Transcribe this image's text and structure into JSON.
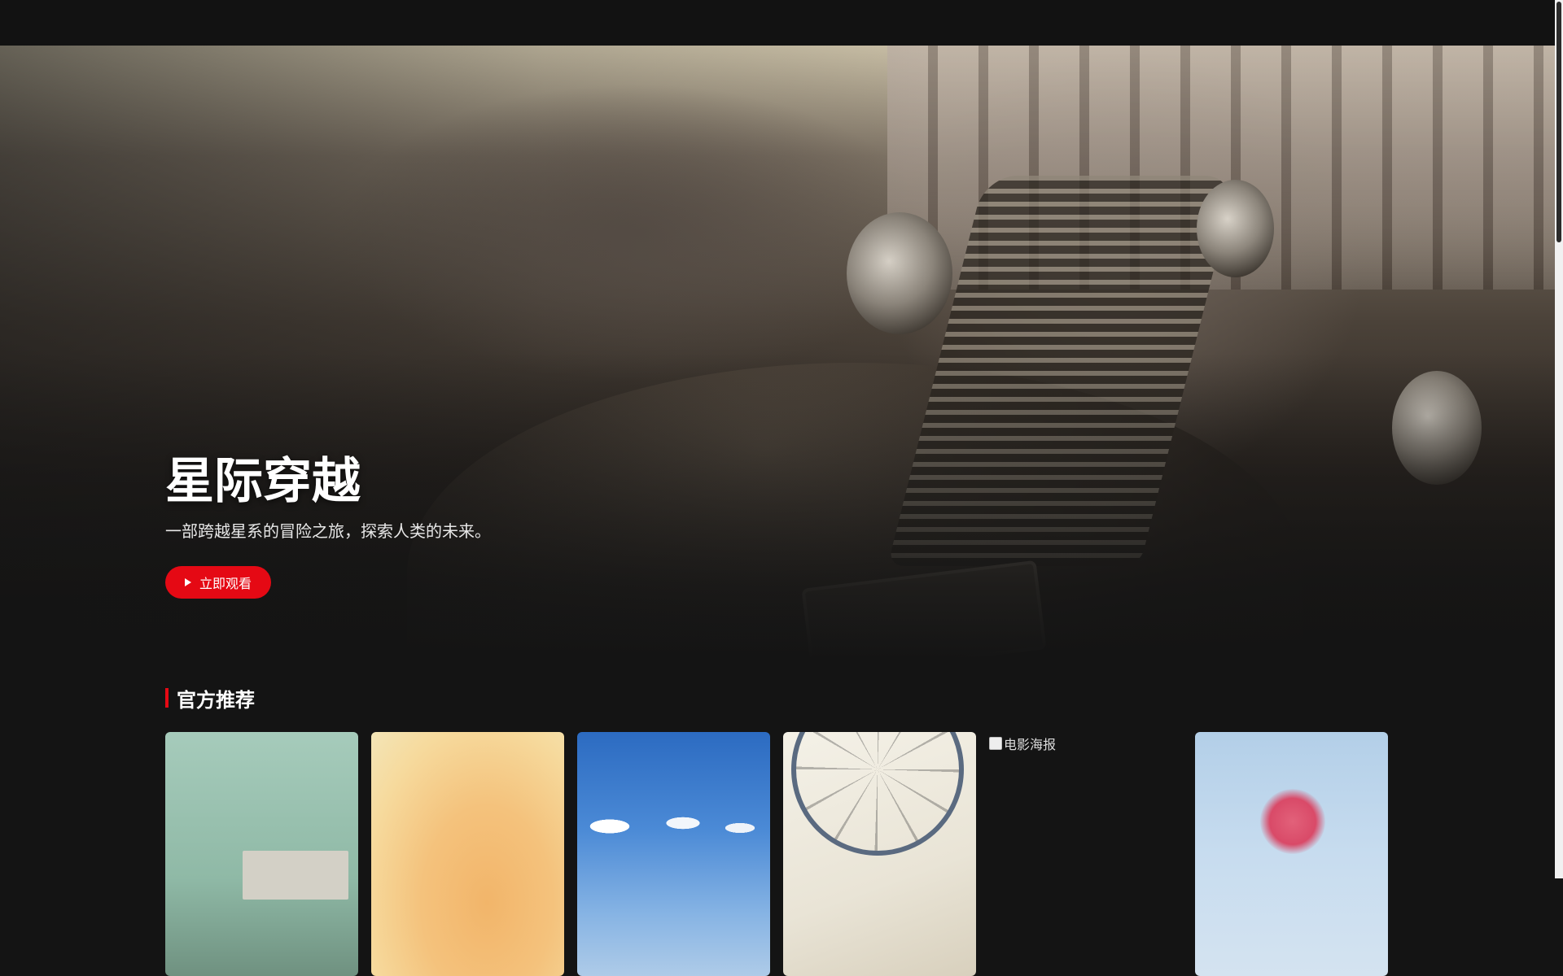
{
  "hero": {
    "title": "星际穿越",
    "description": "一部跨越星系的冒险之旅，探索人类的未来。",
    "watch_label": "立即观看"
  },
  "recommend": {
    "heading": "官方推荐",
    "cards": [
      {
        "alt": "电影海报",
        "loaded": true
      },
      {
        "alt": "电影海报",
        "loaded": true
      },
      {
        "alt": "电影海报",
        "loaded": true
      },
      {
        "alt": "电影海报",
        "loaded": true
      },
      {
        "alt": "电影海报",
        "loaded": false
      },
      {
        "alt": "电影海报",
        "loaded": true
      }
    ]
  },
  "colors": {
    "accent": "#e50914",
    "background": "#141414",
    "topbar": "#121212"
  },
  "icons": {
    "watch_button_icon": "play-icon",
    "broken_image_icon": "broken-image-icon"
  }
}
